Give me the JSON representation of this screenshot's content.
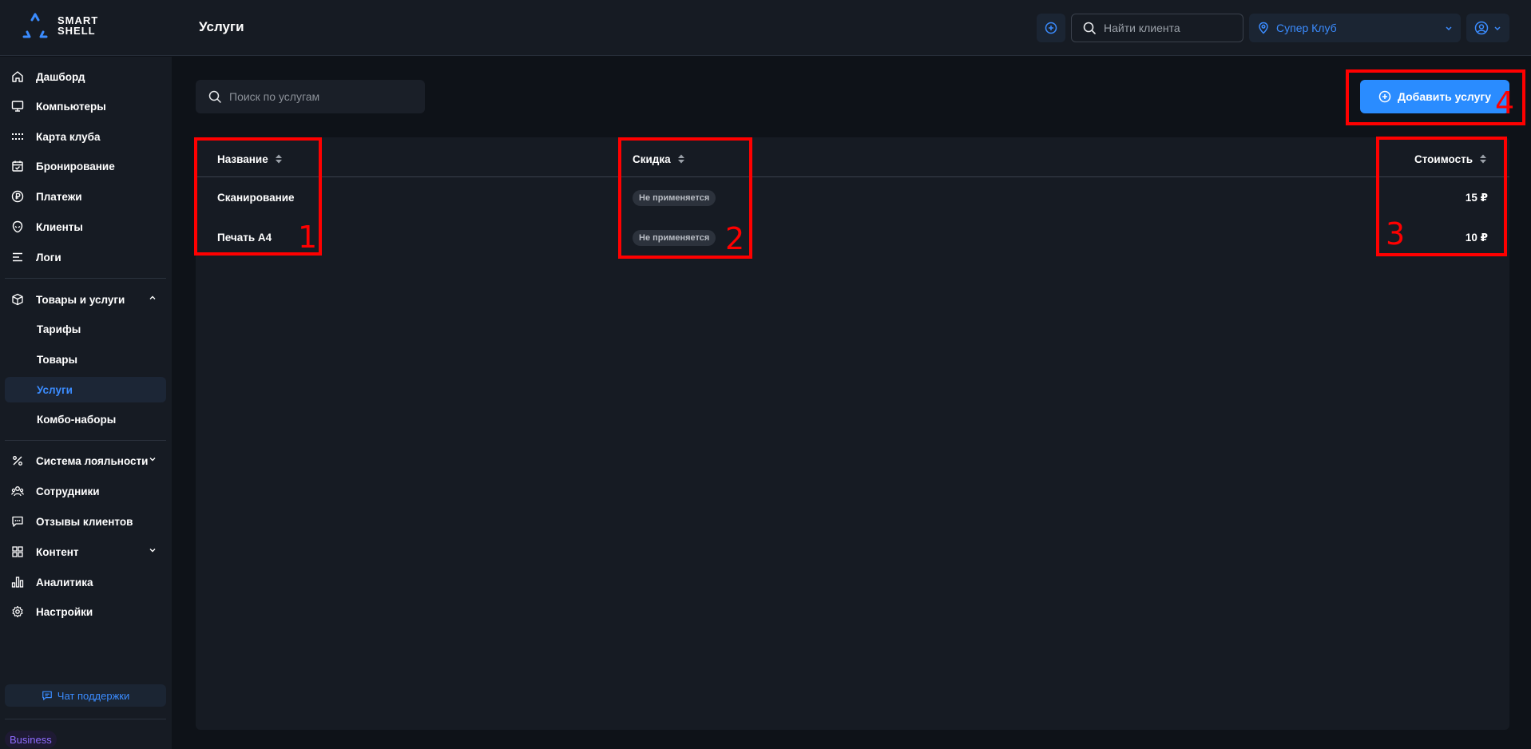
{
  "logo": {
    "line1": "SMART",
    "line2": "SHELL"
  },
  "header": {
    "title": "Услуги",
    "search_placeholder": "Найти клиента",
    "club": "Супер Клуб"
  },
  "sidebar": {
    "items": [
      {
        "label": "Дашборд",
        "icon": "home-icon"
      },
      {
        "label": "Компьютеры",
        "icon": "monitor-icon"
      },
      {
        "label": "Карта клуба",
        "icon": "grid-dots-icon"
      },
      {
        "label": "Бронирование",
        "icon": "calendar-icon"
      },
      {
        "label": "Платежи",
        "icon": "ruble-coin-icon"
      },
      {
        "label": "Клиенты",
        "icon": "alien-icon"
      },
      {
        "label": "Логи",
        "icon": "lines-icon"
      }
    ],
    "goods": {
      "label": "Товары и услуги",
      "icon": "box-icon"
    },
    "sub_items": [
      {
        "label": "Тарифы"
      },
      {
        "label": "Товары"
      },
      {
        "label": "Услуги",
        "active": true
      },
      {
        "label": "Комбо-наборы"
      }
    ],
    "items2": [
      {
        "label": "Система лояльности",
        "icon": "percent-icon",
        "expandable": true
      },
      {
        "label": "Сотрудники",
        "icon": "users-icon"
      },
      {
        "label": "Отзывы клиентов",
        "icon": "chat-icon"
      },
      {
        "label": "Контент",
        "icon": "tiles-icon",
        "expandable": true
      },
      {
        "label": "Аналитика",
        "icon": "bar-chart-icon"
      },
      {
        "label": "Настройки",
        "icon": "gear-icon"
      }
    ],
    "support": "Чат поддержки",
    "plan": "Business"
  },
  "main": {
    "search_placeholder": "Поиск по услугам",
    "add_button": "Добавить услугу",
    "columns": {
      "name": "Название",
      "discount": "Скидка",
      "price": "Стоимость"
    },
    "rows": [
      {
        "name": "Сканирование",
        "discount": "Не применяется",
        "price": "15 ₽"
      },
      {
        "name": "Печать А4",
        "discount": "Не применяется",
        "price": "10 ₽"
      }
    ]
  },
  "annotations": {
    "n1": "1",
    "n2": "2",
    "n3": "3",
    "n4": "4"
  },
  "colors": {
    "accent": "#2a8cff",
    "annotation": "#ff0000",
    "background": "#0e1218",
    "panel": "#161b23"
  }
}
